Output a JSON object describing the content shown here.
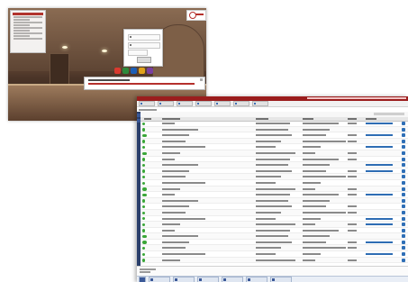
{
  "screen": {
    "login": {
      "menu_items": 9,
      "fields": [
        "username-field",
        "password-field"
      ],
      "app_icons": [
        {
          "name": "app-icon-1",
          "color": "#d93a2f"
        },
        {
          "name": "app-icon-2",
          "color": "#2e8b3c"
        },
        {
          "name": "app-icon-3",
          "color": "#1d5fb6"
        },
        {
          "name": "app-icon-4",
          "color": "#e0a21a"
        },
        {
          "name": "app-icon-5",
          "color": "#7a3fa0"
        }
      ]
    },
    "app": {
      "toolbar_buttons": 7,
      "row_count": 24,
      "accent": "#9b1d1d",
      "row_status_color": "#3aa638",
      "action_button_color": "#2f6fb6"
    }
  }
}
